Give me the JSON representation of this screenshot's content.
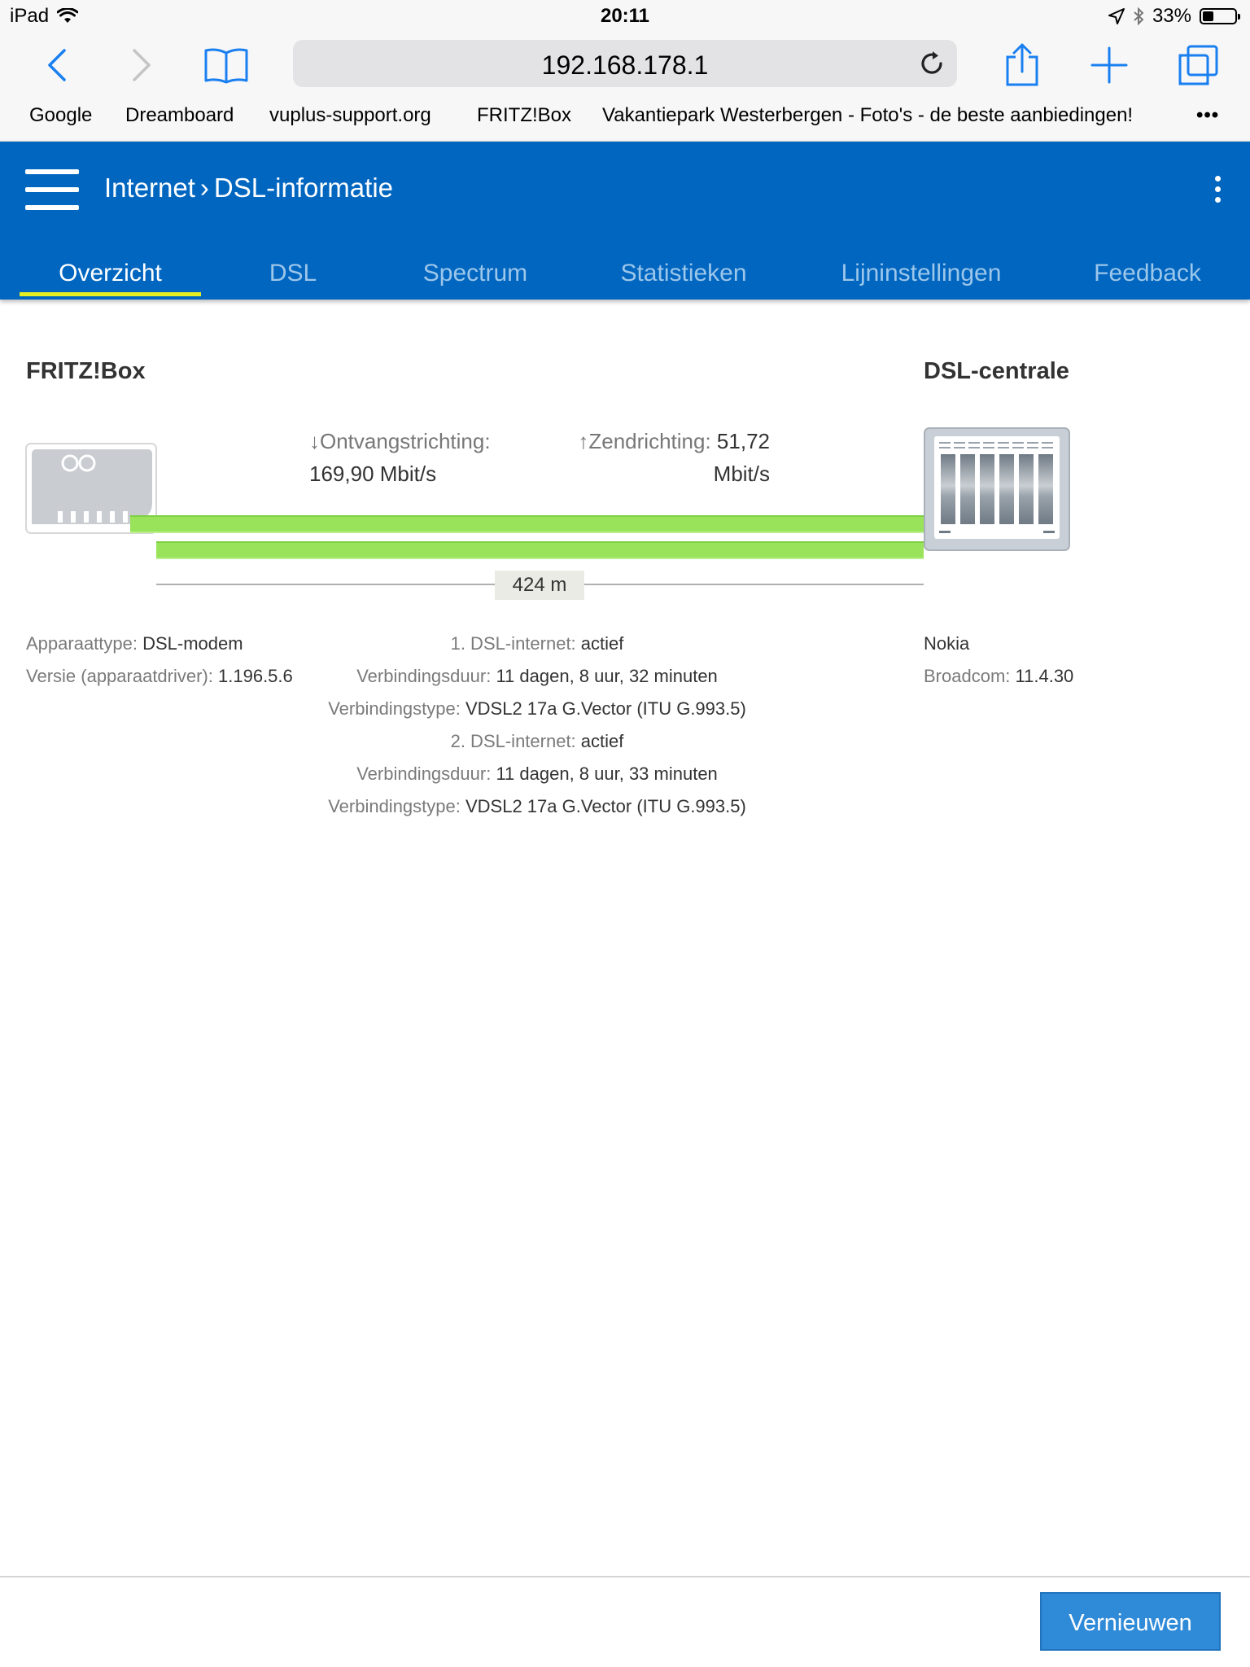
{
  "status_bar": {
    "device": "iPad",
    "time": "20:11",
    "battery": "33%",
    "battery_level": 0.33
  },
  "browser": {
    "url": "192.168.178.1",
    "bookmarks": [
      "Google",
      "Dreamboard",
      "vuplus-support.org",
      "FRITZ!Box",
      "Vakantiepark Westerbergen - Foto's - de beste aanbiedingen!"
    ],
    "more_glyph": "•••"
  },
  "header": {
    "breadcrumb_parent": "Internet",
    "breadcrumb_separator": "›",
    "breadcrumb_current": "DSL-informatie",
    "tabs": [
      {
        "label": "Overzicht",
        "active": true
      },
      {
        "label": "DSL",
        "active": false
      },
      {
        "label": "Spectrum",
        "active": false
      },
      {
        "label": "Statistieken",
        "active": false
      },
      {
        "label": "Lijninstellingen",
        "active": false
      },
      {
        "label": "Feedback",
        "active": false
      }
    ]
  },
  "overview": {
    "left_device_title": "FRITZ!Box",
    "right_device_title": "DSL-centrale",
    "downstream_label": "↓Ontvangstrichting:",
    "downstream_value": "169,90 Mbit/s",
    "upstream_label": "↑Zendrichting:",
    "upstream_value": "51,72",
    "upstream_unit": "Mbit/s",
    "distance": "424 m",
    "left_info": [
      {
        "key": "Apparaattype:",
        "value": "DSL-modem"
      },
      {
        "key": "Versie (apparaatdriver):",
        "value": "1.196.5.6"
      }
    ],
    "center_info": [
      {
        "key": "1. DSL-internet:",
        "value": "actief"
      },
      {
        "key": "Verbindingsduur:",
        "value": "11 dagen, 8 uur, 32 minuten"
      },
      {
        "key": "Verbindingstype:",
        "value": "VDSL2 17a G.Vector (ITU G.993.5)"
      },
      {
        "key": "2. DSL-internet:",
        "value": "actief"
      },
      {
        "key": "Verbindingsduur:",
        "value": "11 dagen, 8 uur, 33 minuten"
      },
      {
        "key": "Verbindingstype:",
        "value": "VDSL2 17a G.Vector (ITU G.993.5)"
      }
    ],
    "right_info": [
      {
        "key": "",
        "value": "Nokia"
      },
      {
        "key": "Broadcom:",
        "value": "11.4.30"
      }
    ]
  },
  "footer": {
    "refresh_label": "Vernieuwen"
  },
  "colors": {
    "header_blue": "#0066c0",
    "active_tab_underline": "#e6ef1f",
    "line_green": "#98e35a",
    "button_blue": "#2f8ad8",
    "ios_blue": "#1a7ff0"
  }
}
